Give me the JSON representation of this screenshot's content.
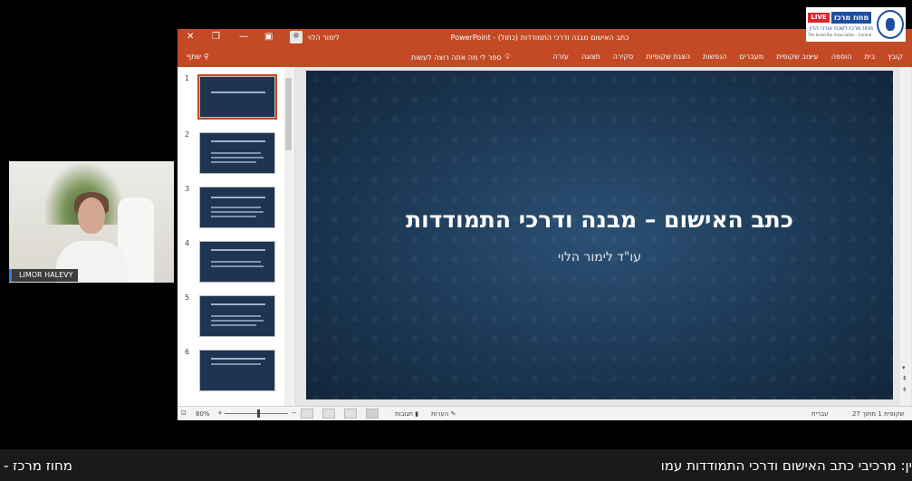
{
  "window": {
    "doc_title": "כתב האישום מבנה ודרכי התמודדות (כתול) - PowerPoint",
    "user_name": "לימור הלוי"
  },
  "ribbon": {
    "tabs": [
      "קובץ",
      "בית",
      "הוספה",
      "עיצוב שקופית",
      "מעברים",
      "הנפשות",
      "הצגת שקופיות",
      "סקירה",
      "תצוגה",
      "עזרה"
    ],
    "tell_me": "ספר לי מה אתה רוצה לעשות",
    "share": "שתף"
  },
  "thumbnails": {
    "numbers": [
      "1",
      "2",
      "3",
      "4",
      "5",
      "6"
    ]
  },
  "slide": {
    "title": "כתב האישום – מבנה ודרכי התמודדות",
    "subtitle": "עו\"ד לימור הלוי"
  },
  "status": {
    "zoom": "80%",
    "notes": "הערות",
    "comments": "תגובות",
    "language": "עברית",
    "slide_info": "שקופית 1 מתוך 27"
  },
  "webcam": {
    "name_tag": "LIMOR HALEVY"
  },
  "logo": {
    "live": "LIVE",
    "name": "מחוז מרכז",
    "sub": "מחוז מרכז לשכת עורכי הדין",
    "sub2": "The Israel Bar Association - Central District"
  },
  "ticker": {
    "right_text": "ין: מרכיבי כתב האישום ודרכי התמודדות עמו",
    "left_text": "מחוז מרכז -"
  },
  "colors": {
    "ppt_accent": "#c34a25",
    "slide_bg": "#1c3855",
    "live_red": "#d8282b",
    "logo_blue": "#1d4ea0"
  }
}
